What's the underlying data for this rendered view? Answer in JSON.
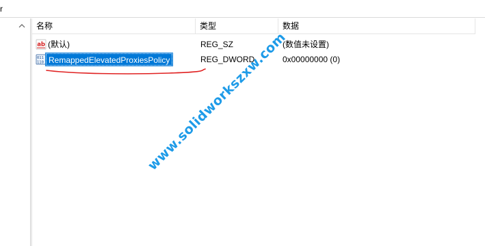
{
  "address_bar": {
    "text": "r"
  },
  "columns": {
    "name": "名称",
    "type": "类型",
    "data": "数据"
  },
  "rows": [
    {
      "icon": "string-value-icon",
      "name": "(默认)",
      "type": "REG_SZ",
      "data": "(数值未设置)",
      "selected": false
    },
    {
      "icon": "dword-value-icon",
      "name": "RemappedElevatedProxiesPolicy",
      "type": "REG_DWORD",
      "data": "0x00000000 (0)",
      "selected": true
    }
  ],
  "watermark": "www.solidworkszxw.com",
  "colors": {
    "selection": "#0078d7",
    "annotation": "#e02020",
    "watermark": "#1e9be8"
  }
}
